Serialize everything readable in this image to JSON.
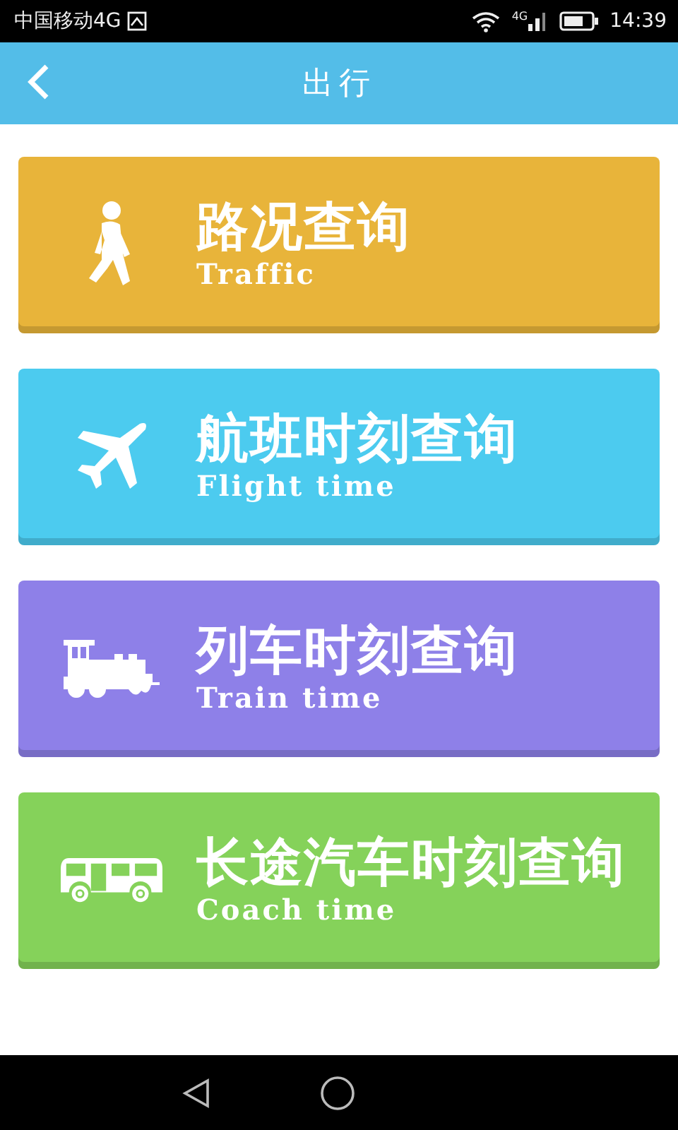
{
  "status_bar": {
    "carrier": "中国移动4G",
    "network": "4G",
    "time": "14:39"
  },
  "header": {
    "title": "出行"
  },
  "options": [
    {
      "kind": "walk",
      "title": "路况查询",
      "subtitle": "Traffic",
      "color": "#e8b43a"
    },
    {
      "kind": "plane",
      "title": "航班时刻查询",
      "subtitle": "Flight time",
      "color": "#4ccbef"
    },
    {
      "kind": "train",
      "title": "列车时刻查询",
      "subtitle": "Train time",
      "color": "#8e80e8"
    },
    {
      "kind": "bus",
      "title": "长途汽车时刻查询",
      "subtitle": "Coach time",
      "color": "#85d25a"
    }
  ]
}
